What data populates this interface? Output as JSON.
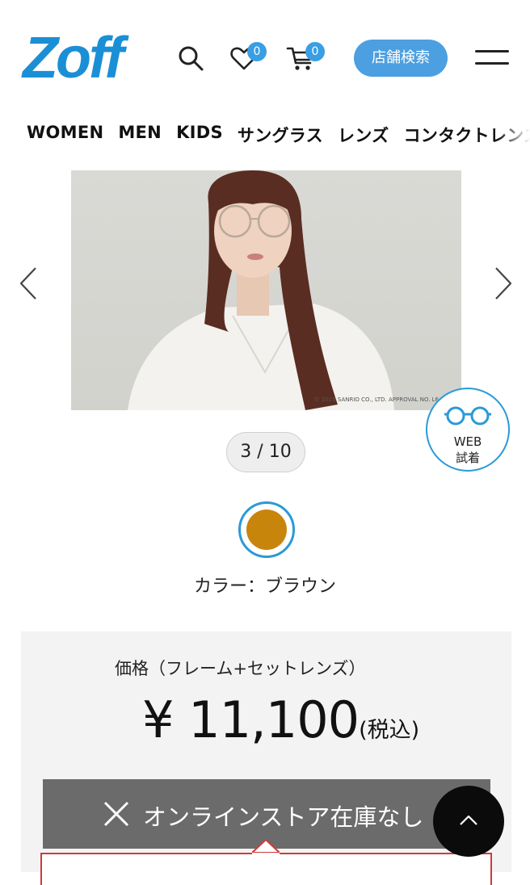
{
  "header": {
    "logo": "Zoff",
    "favorites_count": "0",
    "cart_count": "0",
    "store_search_label": "店舗検索"
  },
  "nav": {
    "items": [
      "WOMEN",
      "MEN",
      "KIDS",
      "サングラス",
      "レンズ",
      "コンタクトレンズ"
    ]
  },
  "gallery": {
    "copyright": "© 2025 SANRIO CO., LTD. APPROVAL NO. L6",
    "counter": "3 / 10",
    "web_fit_line1": "WEB",
    "web_fit_line2": "試着"
  },
  "color": {
    "swatch_hex": "#c8850c",
    "label": "カラー：ブラウン"
  },
  "price": {
    "label": "価格（フレーム+セットレンズ）",
    "amount": "¥ 11,100",
    "tax": "(税込)"
  },
  "stock": {
    "label": "オンラインストア在庫なし"
  },
  "colors": {
    "accent": "#2a9ad6",
    "logo": "#1b8fd6",
    "button_blue": "#4c9fe0",
    "stock_gray": "#6b6b6b",
    "reserve_red": "#d03a3a"
  }
}
